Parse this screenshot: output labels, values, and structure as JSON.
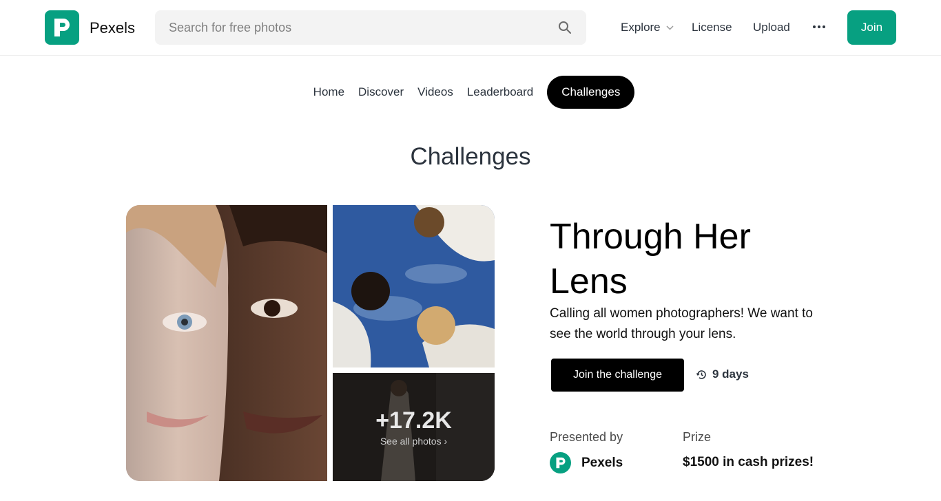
{
  "header": {
    "brand": "Pexels",
    "search_placeholder": "Search for free photos",
    "nav": {
      "explore": "Explore",
      "license": "License",
      "upload": "Upload"
    },
    "join_label": "Join",
    "accent_color": "#07A081"
  },
  "subnav": {
    "items": [
      {
        "label": "Home"
      },
      {
        "label": "Discover"
      },
      {
        "label": "Videos"
      },
      {
        "label": "Leaderboard"
      },
      {
        "label": "Challenges",
        "active": true
      }
    ]
  },
  "page": {
    "title": "Challenges"
  },
  "challenge": {
    "title": "Through Her Lens",
    "description": "Calling all women photographers! We want to see the world through your lens.",
    "cta_label": "Join the challenge",
    "time_left": "9 days",
    "photo_count": "+17.2K",
    "see_all": "See all photos ›",
    "presented_by_label": "Presented by",
    "presenter": "Pexels",
    "prize_label": "Prize",
    "prize": "$1500 in cash prizes!"
  },
  "icons": {
    "logo": "pexels-logo-icon",
    "search": "search-icon",
    "explore_dropdown": "chevron-down-icon",
    "more": "more-horizontal-icon",
    "timer": "history-clock-icon"
  }
}
